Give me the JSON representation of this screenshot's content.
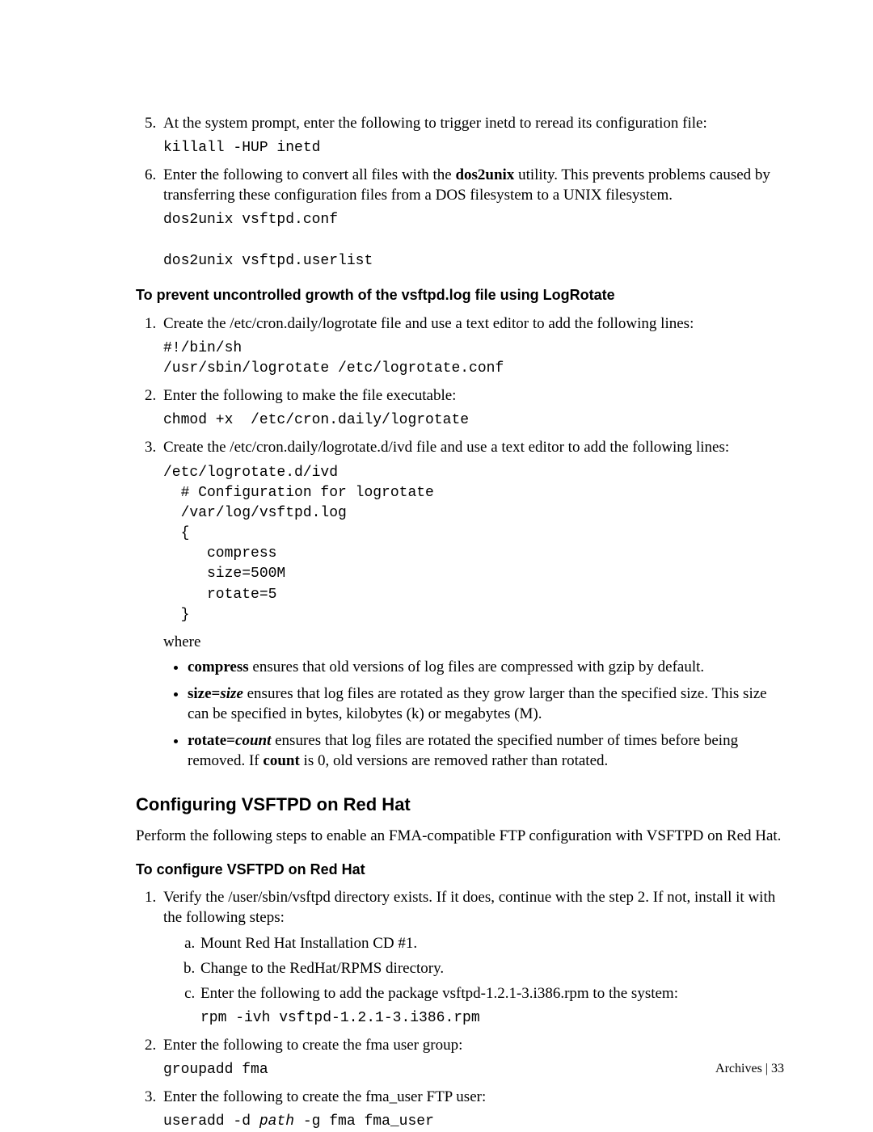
{
  "steps_a": {
    "s5": {
      "text": "At the system prompt, enter the following to trigger inetd to reread its configuration file:",
      "code": "killall -HUP inetd"
    },
    "s6": {
      "pre": "Enter the following to convert all files with the ",
      "bold": "dos2unix",
      "post": " utility. This prevents problems caused by transferring these configuration files from a DOS filesystem to a UNIX filesystem.",
      "code": "dos2unix vsftpd.conf\n\ndos2unix vsftpd.userlist"
    }
  },
  "heading_logrotate": "To prevent uncontrolled growth of the vsftpd.log file using LogRotate",
  "steps_b": {
    "s1": {
      "text": "Create the /etc/cron.daily/logrotate file and use a text editor to add the following lines:",
      "code": "#!/bin/sh\n/usr/sbin/logrotate /etc/logrotate.conf"
    },
    "s2": {
      "text": "Enter the following to make the file executable:",
      "code": "chmod +x  /etc/cron.daily/logrotate"
    },
    "s3": {
      "text": "Create the /etc/cron.daily/logrotate.d/ivd file and use a text editor to add the following lines:",
      "code": "/etc/logrotate.d/ivd\n  # Configuration for logrotate\n  /var/log/vsftpd.log\n  {\n     compress\n     size=500M\n     rotate=5\n  }",
      "where": "where",
      "bullets": {
        "b1_bold": "compress",
        "b1_rest": " ensures that old versions of log files are compressed with gzip by default.",
        "b2_bold": "size=",
        "b2_ital": "size",
        "b2_rest": " ensures that log files are rotated as they grow larger than the specified size. This size can be specified in bytes, kilobytes (k) or megabytes (M).",
        "b3_bold": "rotate=",
        "b3_ital": "count",
        "b3_mid": " ensures that log files are rotated the specified number of times before being removed. If ",
        "b3_bold2": "count",
        "b3_end": " is 0, old versions are removed rather than rotated."
      }
    }
  },
  "heading_redhat_main": "Configuring VSFTPD on Red Hat",
  "intro_redhat": "Perform the following steps to enable an FMA-compatible FTP configuration with VSFTPD on Red Hat.",
  "heading_redhat_sub": "To configure VSFTPD on Red Hat",
  "steps_c": {
    "s1": {
      "text": "Verify the /user/sbin/vsftpd directory exists. If it does, continue with the step 2. If not, install it with the following steps:",
      "a": "Mount Red Hat Installation CD #1.",
      "b": "Change to the RedHat/RPMS directory.",
      "c": "Enter the following to add the package vsftpd-1.2.1-3.i386.rpm to the system:",
      "c_code": "rpm -ivh vsftpd-1.2.1-3.i386.rpm"
    },
    "s2": {
      "text": "Enter the following to create the fma user group:",
      "code": "groupadd fma"
    },
    "s3": {
      "text": "Enter the following to create the fma_user FTP user:",
      "code_pre": "useradd -d ",
      "code_ital": "path",
      "code_post": " -g fma fma_user"
    }
  },
  "footer": "Archives | 33"
}
